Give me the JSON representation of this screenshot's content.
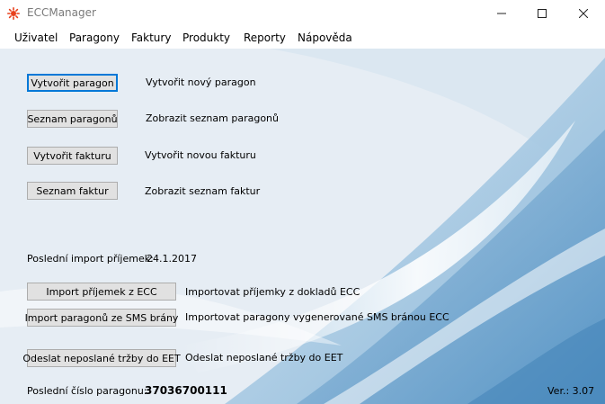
{
  "window": {
    "title": "ECCManager"
  },
  "menu": [
    "Uživatel",
    "Paragony",
    "Faktury",
    "Produkty",
    "Reporty",
    "Nápověda"
  ],
  "actions": {
    "create_receipt": {
      "button": "Vytvořit paragon",
      "desc": "Vytvořit nový paragon"
    },
    "receipt_list": {
      "button": "Seznam paragonů",
      "desc": "Zobrazit seznam paragonů"
    },
    "create_invoice": {
      "button": "Vytvořit fakturu",
      "desc": "Vytvořit novou fakturu"
    },
    "invoice_list": {
      "button": "Seznam faktur",
      "desc": "Zobrazit seznam faktur"
    },
    "import_ecc": {
      "button": "Import příjemek z ECC",
      "desc": "Importovat příjemky z dokladů ECC"
    },
    "import_sms": {
      "button": "Import paragonů ze SMS brány",
      "desc": "Importovat paragony vygenerované SMS bránou ECC"
    },
    "send_eet": {
      "button": "Odeslat neposlané tržby do EET",
      "desc": "Odeslat neposlané tržby do EET"
    }
  },
  "last_import": {
    "label": "Poslední import příjemek:",
    "value": "24.1.2017"
  },
  "footer": {
    "last_receipt_label": "Poslední číslo paragonu:",
    "last_receipt_value": "37036700111",
    "version": "Ver.: 3.07"
  },
  "icons": {
    "app": "app-sun-icon",
    "minimize": "minimize-icon",
    "maximize": "maximize-icon",
    "close": "close-icon"
  },
  "colors": {
    "accent": "#0078d7",
    "app_icon": "#e8401c"
  }
}
